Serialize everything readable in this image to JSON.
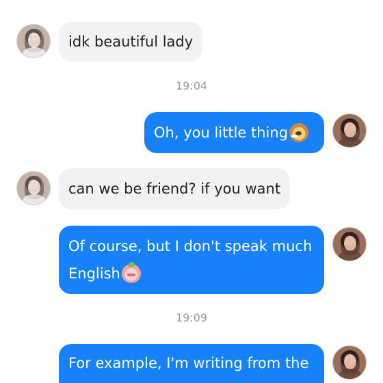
{
  "messages": [
    {
      "type": "in",
      "text": "idk beautiful lady"
    },
    {
      "type": "time",
      "text": "19:04"
    },
    {
      "type": "out",
      "text": "Oh, you little thing"
    },
    {
      "type": "in",
      "text": "can we be friend? if you want"
    },
    {
      "type": "out",
      "lines": [
        "Of course, but I don't speak much",
        "English"
      ]
    },
    {
      "type": "time",
      "text": "19:09"
    },
    {
      "type": "out",
      "text": "For example, I'm writing from the"
    }
  ],
  "icons": {
    "other_avatar": "avatar-icon",
    "self_avatar": "avatar-icon",
    "emoji_1": "dog-emoji-icon",
    "emoji_2": "peach-emoji-icon"
  },
  "colors": {
    "outgoing_bubble": "#1781f7",
    "incoming_bubble": "#f2f2f2",
    "time_text": "#9a9a9a"
  }
}
